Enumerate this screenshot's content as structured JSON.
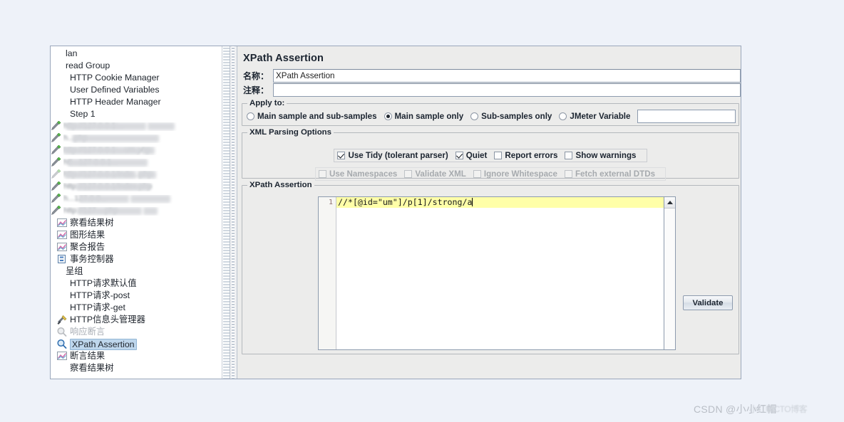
{
  "window": {
    "panel_title": "XPath Assertion"
  },
  "tree": {
    "items": [
      {
        "label": "lan",
        "icon": "none",
        "indent": 0,
        "state": "normal"
      },
      {
        "label": "read Group",
        "icon": "none",
        "indent": 0,
        "state": "normal"
      },
      {
        "label": "HTTP Cookie Manager",
        "icon": "none",
        "indent": 1,
        "state": "normal"
      },
      {
        "label": "User Defined Variables",
        "icon": "none",
        "indent": 1,
        "state": "normal"
      },
      {
        "label": "HTTP Header Manager",
        "icon": "none",
        "indent": 1,
        "state": "normal"
      },
      {
        "label": "Step 1",
        "icon": "none",
        "indent": 1,
        "state": "normal"
      },
      {
        "label": "察看结果树",
        "icon": "chart-icon",
        "indent": 1,
        "state": "normal"
      },
      {
        "label": "图形结果",
        "icon": "chart-icon",
        "indent": 1,
        "state": "normal"
      },
      {
        "label": "聚合报告",
        "icon": "chart-icon",
        "indent": 1,
        "state": "normal"
      },
      {
        "label": "事务控制器",
        "icon": "controller-icon",
        "indent": 1,
        "state": "normal"
      },
      {
        "label": "呈组",
        "icon": "none",
        "indent": 0,
        "state": "normal"
      },
      {
        "label": "HTTP请求默认值",
        "icon": "none",
        "indent": 1,
        "state": "normal"
      },
      {
        "label": "HTTP请求-post",
        "icon": "none",
        "indent": 1,
        "state": "normal"
      },
      {
        "label": "HTTP请求-get",
        "icon": "none",
        "indent": 1,
        "state": "normal"
      },
      {
        "label": "HTTP信息头管理器",
        "icon": "wrench-icon",
        "indent": 1,
        "state": "normal"
      },
      {
        "label": "响应断言",
        "icon": "magnifier-icon-dim",
        "indent": 1,
        "state": "disabled"
      },
      {
        "label": "XPath Assertion",
        "icon": "magnifier-icon",
        "indent": 1,
        "state": "selected"
      },
      {
        "label": "断言结果",
        "icon": "chart-icon",
        "indent": 1,
        "state": "normal"
      },
      {
        "label": "察看结果树",
        "icon": "none",
        "indent": 1,
        "state": "normal"
      }
    ],
    "redacted_rows": [
      {
        "icon": "http-sampler-icon",
        "hint": "http://127.0.0.1:..."
      },
      {
        "icon": "http-sampler-icon",
        "hint": "h...php"
      },
      {
        "icon": "http-sampler-icon",
        "hint": "http://127.0.0.1:...um.php"
      },
      {
        "icon": "http-sampler-icon",
        "hint": "htt...127.0.0.1..."
      },
      {
        "icon": "http-sampler-icon-dim",
        "hint": "http://127.0.0.1/inde...php"
      },
      {
        "icon": "http-sampler-icon",
        "hint": "http://127.0.0.1/index.php"
      },
      {
        "icon": "http-sampler-icon",
        "hint": "h...127.0.0..."
      },
      {
        "icon": "http-sampler-icon",
        "hint": "http://127....php"
      }
    ]
  },
  "form": {
    "name_label": "名称：",
    "name_value": "XPath Assertion",
    "comment_label": "注释：",
    "comment_value": ""
  },
  "apply_to": {
    "title": "Apply to:",
    "options": [
      {
        "label": "Main sample and sub-samples",
        "selected": false
      },
      {
        "label": "Main sample only",
        "selected": true
      },
      {
        "label": "Sub-samples only",
        "selected": false
      },
      {
        "label": "JMeter Variable",
        "selected": false
      }
    ],
    "variable_value": ""
  },
  "xml_parsing": {
    "title": "XML Parsing Options",
    "row1": [
      {
        "label": "Use Tidy (tolerant parser)",
        "checked": true,
        "enabled": true
      },
      {
        "label": "Quiet",
        "checked": true,
        "enabled": true
      },
      {
        "label": "Report errors",
        "checked": false,
        "enabled": true
      },
      {
        "label": "Show warnings",
        "checked": false,
        "enabled": true
      }
    ],
    "row2": [
      {
        "label": "Use Namespaces",
        "checked": false,
        "enabled": false
      },
      {
        "label": "Validate XML",
        "checked": false,
        "enabled": false
      },
      {
        "label": "Ignore Whitespace",
        "checked": false,
        "enabled": false
      },
      {
        "label": "Fetch external DTDs",
        "checked": false,
        "enabled": false
      }
    ]
  },
  "xpath_section": {
    "title": "XPath Assertion",
    "line_number": "1",
    "expression": "//*[@id=\"um\"]/p[1]/strong/a",
    "validate_label": "Validate"
  },
  "watermark": {
    "text": "CSDN @小小红帽",
    "ghost": "小红帽CTO博客"
  },
  "colors": {
    "selection": "#bed6ec",
    "code_highlight": "#ffffa8",
    "panel_bg": "#ececeb",
    "page_bg": "#eef2f9"
  }
}
